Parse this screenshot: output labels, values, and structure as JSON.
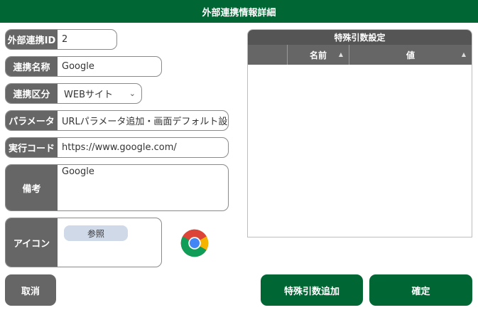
{
  "window": {
    "title": "外部連携情報詳細"
  },
  "form": {
    "external_id": {
      "label": "外部連携ID",
      "value": "2"
    },
    "name": {
      "label": "連携名称",
      "value": "Google"
    },
    "type": {
      "label": "連携区分",
      "value": "WEBサイト"
    },
    "params": {
      "label": "パラメータ",
      "value": "URLパラメータ追加・画面デフォルト設"
    },
    "exec_code": {
      "label": "実行コード",
      "value": "https://www.google.com/"
    },
    "notes": {
      "label": "備考",
      "value": "Google"
    },
    "icon": {
      "label": "アイコン",
      "browse_label": "参照",
      "icon_name": "chrome-icon"
    }
  },
  "grid": {
    "title": "特殊引数設定",
    "columns": [
      "",
      "名前",
      "値"
    ],
    "rows": []
  },
  "buttons": {
    "cancel": "取消",
    "add_param": "特殊引数追加",
    "confirm": "確定"
  },
  "colors": {
    "header_green": "#006633",
    "label_gray": "#666666",
    "browse_blue": "#cfd9e8"
  }
}
